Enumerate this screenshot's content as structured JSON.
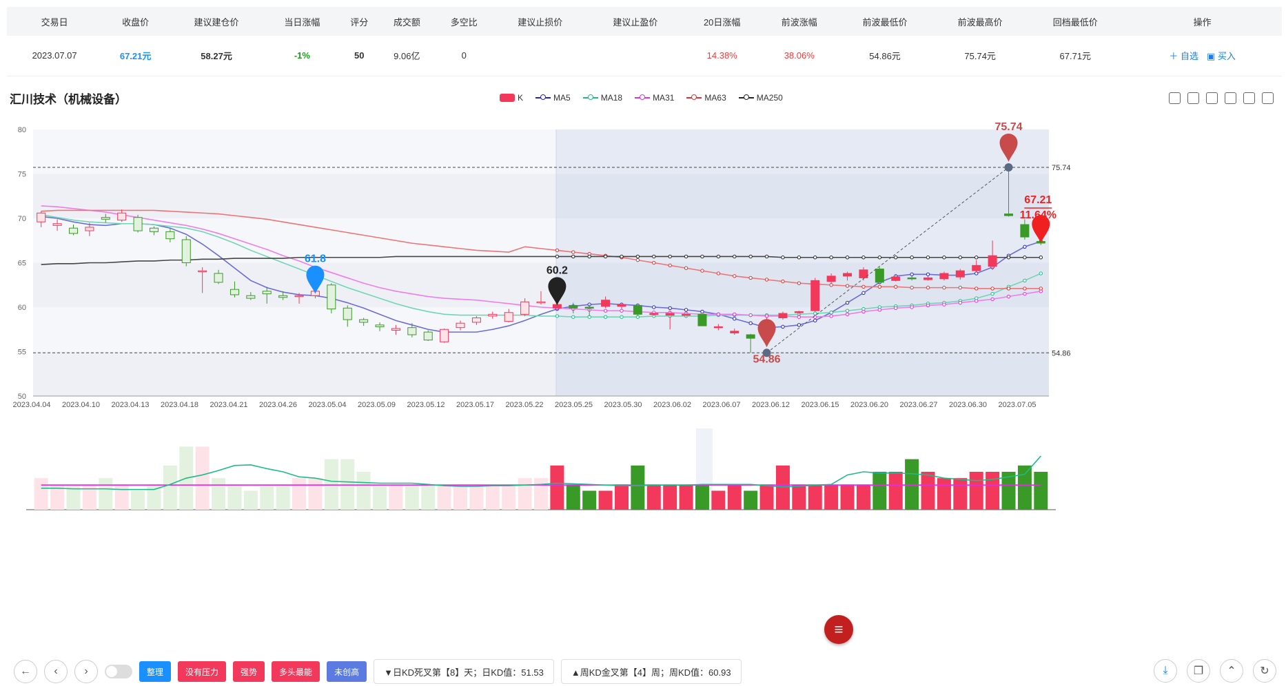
{
  "table": {
    "headers": [
      "交易日",
      "收盘价",
      "建议建仓价",
      "当日涨幅",
      "评分",
      "成交额",
      "多空比",
      "建议止损价",
      "建议止盈价",
      "20日涨幅",
      "前波涨幅",
      "前波最低价",
      "前波最高价",
      "回档最低价",
      "操作"
    ],
    "row": [
      "2023.07.07",
      "67.21元",
      "58.27元",
      "-1%",
      "50",
      "9.06亿",
      "0",
      "",
      "",
      "14.38%",
      "38.06%",
      "54.86元",
      "75.74元",
      "67.71元"
    ],
    "actions": [
      "＋ 自选",
      "▣ 买入"
    ]
  },
  "title": "汇川技术（机械设备）",
  "legend": [
    {
      "name": "K",
      "color": "#f2385b",
      "type": "rect"
    },
    {
      "name": "MA5",
      "color": "#2222cc",
      "type": "line"
    },
    {
      "name": "MA18",
      "color": "#1dbb8a",
      "type": "line"
    },
    {
      "name": "MA31",
      "color": "#e02ee0",
      "type": "line"
    },
    {
      "name": "MA63",
      "color": "#e03030",
      "type": "line"
    },
    {
      "name": "MA250",
      "color": "#222222",
      "type": "line"
    }
  ],
  "chart_data": {
    "type": "candlestick",
    "ylim": [
      50,
      80
    ],
    "yticks": [
      50,
      55,
      60,
      65,
      70,
      75,
      80
    ],
    "xlabels": [
      "2023.04.04",
      "2023.04.10",
      "2023.04.13",
      "2023.04.18",
      "2023.04.21",
      "2023.04.26",
      "2023.05.04",
      "2023.05.09",
      "2023.05.12",
      "2023.05.17",
      "2023.05.22",
      "2023.05.25",
      "2023.05.30",
      "2023.06.02",
      "2023.06.07",
      "2023.06.12",
      "2023.06.15",
      "2023.06.20",
      "2023.06.27",
      "2023.06.30",
      "2023.07.05"
    ],
    "hlines": [
      {
        "value": 75.74,
        "label": "75.74"
      },
      {
        "value": 54.86,
        "label": "54.86"
      }
    ],
    "markers": [
      {
        "label": "61.8",
        "index": 17,
        "value": 61.5,
        "color": "#1a90ff"
      },
      {
        "label": "60.2",
        "index": 32,
        "value": 60.2,
        "color": "#222"
      },
      {
        "label": "54.86",
        "index": 45,
        "value": 54.86,
        "color": "#c94a4a"
      },
      {
        "label": "75.74",
        "index": 60,
        "value": 75.74,
        "color": "#c94a4a"
      },
      {
        "label": "67.21",
        "index": 62,
        "value": 67.21,
        "color": "#f02020",
        "sub": "11.64%"
      }
    ],
    "candles": [
      {
        "o": 69.6,
        "c": 70.6,
        "h": 70.8,
        "l": 69.0
      },
      {
        "o": 69.2,
        "c": 69.4,
        "h": 69.9,
        "l": 68.6
      },
      {
        "o": 68.9,
        "c": 68.3,
        "h": 69.3,
        "l": 68.1
      },
      {
        "o": 68.6,
        "c": 69.0,
        "h": 69.5,
        "l": 68.0
      },
      {
        "o": 70.1,
        "c": 69.9,
        "h": 70.5,
        "l": 69.5
      },
      {
        "o": 69.8,
        "c": 70.6,
        "h": 71.0,
        "l": 69.6
      },
      {
        "o": 70.1,
        "c": 68.6,
        "h": 70.4,
        "l": 68.4
      },
      {
        "o": 68.9,
        "c": 68.5,
        "h": 69.1,
        "l": 68.1
      },
      {
        "o": 68.5,
        "c": 67.7,
        "h": 68.9,
        "l": 67.3
      },
      {
        "o": 67.6,
        "c": 65.0,
        "h": 68.0,
        "l": 64.6
      },
      {
        "o": 64.0,
        "c": 64.1,
        "h": 64.5,
        "l": 61.6
      },
      {
        "o": 63.8,
        "c": 62.8,
        "h": 64.2,
        "l": 62.6
      },
      {
        "o": 62.0,
        "c": 61.4,
        "h": 62.9,
        "l": 61.1
      },
      {
        "o": 61.3,
        "c": 61.0,
        "h": 61.7,
        "l": 60.8
      },
      {
        "o": 61.8,
        "c": 61.5,
        "h": 62.3,
        "l": 60.4
      },
      {
        "o": 61.3,
        "c": 61.1,
        "h": 61.8,
        "l": 60.8
      },
      {
        "o": 61.2,
        "c": 61.3,
        "h": 61.6,
        "l": 60.4
      },
      {
        "o": 61.3,
        "c": 61.8,
        "h": 62.2,
        "l": 61.0
      },
      {
        "o": 62.5,
        "c": 59.8,
        "h": 62.7,
        "l": 59.3
      },
      {
        "o": 59.9,
        "c": 58.6,
        "h": 60.2,
        "l": 57.8
      },
      {
        "o": 58.6,
        "c": 58.3,
        "h": 58.8,
        "l": 57.9
      },
      {
        "o": 58.0,
        "c": 57.8,
        "h": 58.3,
        "l": 57.3
      },
      {
        "o": 57.4,
        "c": 57.6,
        "h": 58.0,
        "l": 56.9
      },
      {
        "o": 57.7,
        "c": 56.9,
        "h": 58.2,
        "l": 56.6
      },
      {
        "o": 57.2,
        "c": 56.3,
        "h": 57.4,
        "l": 56.2
      },
      {
        "o": 56.1,
        "c": 57.5,
        "h": 57.6,
        "l": 56.0
      },
      {
        "o": 57.7,
        "c": 58.2,
        "h": 58.5,
        "l": 57.4
      },
      {
        "o": 58.3,
        "c": 58.8,
        "h": 59.0,
        "l": 58.0
      },
      {
        "o": 59.0,
        "c": 59.2,
        "h": 59.5,
        "l": 58.7
      },
      {
        "o": 58.4,
        "c": 59.4,
        "h": 59.8,
        "l": 58.3
      },
      {
        "o": 59.2,
        "c": 60.6,
        "h": 61.0,
        "l": 59.0
      },
      {
        "o": 60.5,
        "c": 60.6,
        "h": 61.8,
        "l": 60.3
      },
      {
        "o": 59.9,
        "c": 60.3,
        "h": 60.4,
        "l": 59.8
      },
      {
        "o": 60.2,
        "c": 59.9,
        "h": 60.5,
        "l": 59.3
      },
      {
        "o": 60.0,
        "c": 59.9,
        "h": 60.3,
        "l": 59.0
      },
      {
        "o": 60.1,
        "c": 60.8,
        "h": 61.2,
        "l": 59.9
      },
      {
        "o": 60.1,
        "c": 60.3,
        "h": 60.5,
        "l": 59.8
      },
      {
        "o": 60.2,
        "c": 59.2,
        "h": 60.4,
        "l": 59.0
      },
      {
        "o": 59.2,
        "c": 59.3,
        "h": 59.4,
        "l": 59.0
      },
      {
        "o": 59.1,
        "c": 59.3,
        "h": 59.6,
        "l": 57.5
      },
      {
        "o": 59.1,
        "c": 59.2,
        "h": 59.4,
        "l": 58.9
      },
      {
        "o": 59.2,
        "c": 57.9,
        "h": 59.4,
        "l": 57.9
      },
      {
        "o": 57.7,
        "c": 57.8,
        "h": 58.1,
        "l": 57.4
      },
      {
        "o": 57.1,
        "c": 57.3,
        "h": 57.6,
        "l": 56.9
      },
      {
        "o": 56.9,
        "c": 56.5,
        "h": 57.0,
        "l": 54.86
      },
      {
        "o": 56.7,
        "c": 58.5,
        "h": 58.9,
        "l": 56.6
      },
      {
        "o": 58.8,
        "c": 59.3,
        "h": 59.5,
        "l": 58.6
      },
      {
        "o": 59.4,
        "c": 59.5,
        "h": 59.6,
        "l": 59.0
      },
      {
        "o": 59.6,
        "c": 63.0,
        "h": 63.3,
        "l": 59.5
      },
      {
        "o": 62.9,
        "c": 63.5,
        "h": 63.8,
        "l": 62.6
      },
      {
        "o": 63.5,
        "c": 63.8,
        "h": 64.0,
        "l": 63.0
      },
      {
        "o": 63.3,
        "c": 64.2,
        "h": 64.5,
        "l": 63.0
      },
      {
        "o": 64.3,
        "c": 62.8,
        "h": 64.5,
        "l": 62.6
      },
      {
        "o": 63.0,
        "c": 63.4,
        "h": 63.7,
        "l": 62.9
      },
      {
        "o": 63.3,
        "c": 63.2,
        "h": 63.5,
        "l": 63.0
      },
      {
        "o": 63.1,
        "c": 63.3,
        "h": 63.5,
        "l": 63.0
      },
      {
        "o": 63.2,
        "c": 63.8,
        "h": 64.0,
        "l": 63.0
      },
      {
        "o": 63.4,
        "c": 64.1,
        "h": 64.3,
        "l": 63.1
      },
      {
        "o": 64.1,
        "c": 64.7,
        "h": 65.3,
        "l": 63.9
      },
      {
        "o": 64.6,
        "c": 65.8,
        "h": 67.5,
        "l": 64.2
      },
      {
        "o": 70.5,
        "c": 70.3,
        "h": 75.74,
        "l": 70.2
      },
      {
        "o": 69.3,
        "c": 67.9,
        "h": 69.9,
        "l": 67.6
      },
      {
        "o": 67.4,
        "c": 67.21,
        "h": 68.1,
        "l": 67.0
      }
    ],
    "ma": {
      "MA5": [
        70.2,
        70.0,
        69.6,
        69.3,
        69.2,
        69.4,
        69.4,
        69.3,
        68.9,
        68.2,
        67.1,
        65.8,
        64.4,
        63.0,
        62.2,
        61.7,
        61.4,
        61.3,
        61.0,
        60.5,
        59.9,
        59.2,
        58.5,
        58.0,
        57.5,
        57.2,
        57.2,
        57.2,
        57.5,
        57.9,
        58.5,
        59.2,
        59.8,
        60.1,
        60.3,
        60.4,
        60.3,
        60.2,
        60.0,
        59.9,
        59.7,
        59.5,
        59.2,
        58.7,
        58.2,
        57.7,
        57.8,
        58.0,
        58.5,
        59.4,
        60.5,
        61.6,
        62.8,
        63.5,
        63.7,
        63.7,
        63.6,
        63.6,
        63.8,
        64.5,
        65.8,
        66.8,
        67.4
      ],
      "MA18": [
        70.4,
        70.1,
        69.8,
        69.6,
        69.5,
        69.4,
        69.4,
        69.3,
        69.1,
        68.9,
        68.5,
        67.9,
        67.2,
        66.4,
        65.7,
        65.0,
        64.3,
        63.6,
        62.9,
        62.2,
        61.6,
        61.0,
        60.4,
        59.9,
        59.5,
        59.2,
        59.1,
        59.1,
        59.1,
        59.1,
        59.1,
        59.0,
        59.0,
        58.9,
        58.9,
        58.9,
        58.9,
        58.9,
        59.0,
        59.0,
        59.0,
        59.0,
        59.1,
        59.1,
        59.1,
        59.1,
        59.1,
        59.2,
        59.3,
        59.4,
        59.6,
        59.8,
        60.0,
        60.1,
        60.2,
        60.4,
        60.5,
        60.7,
        61.0,
        61.5,
        62.3,
        63.0,
        63.8
      ],
      "MA31": [
        71.4,
        71.3,
        71.1,
        70.9,
        70.7,
        70.4,
        70.1,
        69.8,
        69.5,
        69.2,
        68.8,
        68.3,
        67.7,
        67.1,
        66.5,
        65.8,
        65.2,
        64.5,
        63.9,
        63.3,
        62.7,
        62.2,
        61.8,
        61.5,
        61.2,
        61.0,
        60.9,
        60.8,
        60.6,
        60.4,
        60.2,
        60.0,
        59.9,
        59.8,
        59.7,
        59.6,
        59.6,
        59.5,
        59.4,
        59.4,
        59.3,
        59.2,
        59.2,
        59.2,
        59.1,
        59.0,
        59.0,
        58.9,
        58.9,
        59.0,
        59.2,
        59.5,
        59.7,
        59.9,
        60.0,
        60.2,
        60.3,
        60.5,
        60.7,
        60.9,
        61.2,
        61.5,
        61.8
      ],
      "MA63": [
        70.8,
        70.9,
        70.9,
        70.9,
        70.9,
        70.9,
        70.9,
        70.9,
        70.8,
        70.7,
        70.6,
        70.5,
        70.3,
        70.1,
        69.9,
        69.6,
        69.3,
        69.0,
        68.7,
        68.4,
        68.1,
        67.8,
        67.5,
        67.2,
        67.0,
        66.8,
        66.6,
        66.4,
        66.3,
        66.2,
        66.8,
        66.6,
        66.4,
        66.2,
        66.0,
        65.8,
        65.6,
        65.3,
        65.0,
        64.7,
        64.4,
        64.1,
        63.8,
        63.5,
        63.3,
        63.1,
        62.9,
        62.7,
        62.6,
        62.5,
        62.4,
        62.3,
        62.3,
        62.3,
        62.2,
        62.2,
        62.2,
        62.2,
        62.1,
        62.1,
        62.1,
        62.1,
        62.1
      ],
      "MA250": [
        64.8,
        64.9,
        64.9,
        65.0,
        65.0,
        65.1,
        65.2,
        65.2,
        65.3,
        65.3,
        65.4,
        65.4,
        65.5,
        65.5,
        65.5,
        65.5,
        65.6,
        65.6,
        65.6,
        65.6,
        65.6,
        65.6,
        65.7,
        65.7,
        65.7,
        65.7,
        65.7,
        65.7,
        65.7,
        65.7,
        65.7,
        65.7,
        65.7,
        65.7,
        65.7,
        65.7,
        65.7,
        65.7,
        65.7,
        65.7,
        65.7,
        65.7,
        65.7,
        65.7,
        65.7,
        65.7,
        65.6,
        65.6,
        65.6,
        65.6,
        65.6,
        65.6,
        65.6,
        65.6,
        65.6,
        65.6,
        65.6,
        65.6,
        65.6,
        65.6,
        65.6,
        65.6,
        65.6
      ]
    },
    "volume": [
      0.5,
      0.4,
      0.4,
      0.4,
      0.5,
      0.4,
      0.3,
      0.4,
      0.7,
      1.0,
      1.0,
      0.5,
      0.4,
      0.3,
      0.4,
      0.4,
      0.5,
      0.5,
      0.8,
      0.8,
      0.6,
      0.4,
      0.4,
      0.4,
      0.4,
      0.4,
      0.4,
      0.4,
      0.4,
      0.4,
      0.5,
      0.5,
      0.7,
      0.4,
      0.3,
      0.3,
      0.4,
      0.7,
      0.4,
      0.4,
      0.4,
      0.4,
      0.3,
      0.4,
      0.3,
      0.4,
      0.7,
      0.4,
      0.4,
      0.4,
      0.4,
      0.4,
      0.6,
      0.6,
      0.8,
      0.6,
      0.5,
      0.5,
      0.6,
      0.6,
      0.6,
      0.7,
      0.6,
      0.8,
      0.4,
      0.3
    ],
    "sentiment": {
      "vol_pink_line": 0.39,
      "vol_green_line": [
        0.34,
        0.34,
        0.33,
        0.33,
        0.33,
        0.32,
        0.32,
        0.32,
        0.4,
        0.5,
        0.55,
        0.62,
        0.7,
        0.71,
        0.65,
        0.6,
        0.52,
        0.5,
        0.45,
        0.44,
        0.43,
        0.42,
        0.42,
        0.42,
        0.4,
        0.38,
        0.37,
        0.37,
        0.38,
        0.38,
        0.39,
        0.4,
        0.42,
        0.41,
        0.4,
        0.39,
        0.38,
        0.38,
        0.39,
        0.39,
        0.39,
        0.4,
        0.4,
        0.4,
        0.4,
        0.38,
        0.36,
        0.37,
        0.39,
        0.4,
        0.55,
        0.6,
        0.58,
        0.58,
        0.57,
        0.55,
        0.5,
        0.48,
        0.46,
        0.48,
        0.52,
        0.56,
        0.85
      ]
    }
  },
  "controls": {
    "tags": [
      {
        "label": "整理",
        "color": "#1a90ff"
      },
      {
        "label": "没有压力",
        "color": "#f2385b"
      },
      {
        "label": "强势",
        "color": "#f2385b"
      },
      {
        "label": "多头最能",
        "color": "#f2385b"
      },
      {
        "label": "未创高",
        "color": "#5b7be0"
      }
    ],
    "info1": "▼日KD死叉第【8】天；日KD值：51.53",
    "info2": "▲周KD金叉第【4】周；周KD值：60.93"
  }
}
